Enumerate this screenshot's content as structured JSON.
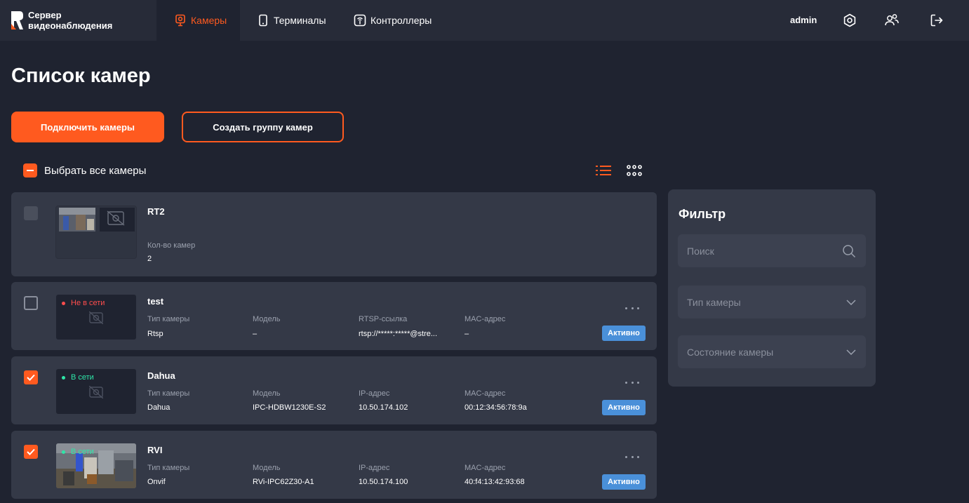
{
  "brand": {
    "line1": "Сервер",
    "line2": "видеонаблюдения"
  },
  "nav": [
    {
      "label": "Камеры",
      "icon": "camera-icon",
      "active": true
    },
    {
      "label": "Терминалы",
      "icon": "terminal-icon",
      "active": false
    },
    {
      "label": "Контроллеры",
      "icon": "controller-icon",
      "active": false
    }
  ],
  "header": {
    "user": "admin"
  },
  "page": {
    "title": "Список камер"
  },
  "actions": {
    "connect": "Подключить камеры",
    "create_group": "Создать группу камер"
  },
  "select_all": {
    "label": "Выбрать все камеры"
  },
  "cards": [
    {
      "title": "RT2",
      "count_label": "Кол-во камер",
      "count_value": "2",
      "checked": false
    },
    {
      "title": "test",
      "status": "Не в сети",
      "checked": false,
      "fields": [
        {
          "label": "Тип камеры",
          "value": "Rtsp"
        },
        {
          "label": "Модель",
          "value": "–"
        },
        {
          "label": "RTSP-ссылка",
          "value": "rtsp://*****:*****@stre..."
        },
        {
          "label": "MAC-адрес",
          "value": "–"
        }
      ],
      "badge": "Активно"
    },
    {
      "title": "Dahua",
      "status": "В сети",
      "checked": true,
      "fields": [
        {
          "label": "Тип камеры",
          "value": "Dahua"
        },
        {
          "label": "Модель",
          "value": "IPC-HDBW1230E-S2"
        },
        {
          "label": "IP-адрес",
          "value": "10.50.174.102"
        },
        {
          "label": "MAC-адрес",
          "value": "00:12:34:56:78:9a"
        }
      ],
      "badge": "Активно"
    },
    {
      "title": "RVI",
      "status": "В сети",
      "checked": true,
      "fields": [
        {
          "label": "Тип камеры",
          "value": "Onvif"
        },
        {
          "label": "Модель",
          "value": "RVi-IPC62Z30-A1"
        },
        {
          "label": "IP-адрес",
          "value": "10.50.174.100"
        },
        {
          "label": "MAC-адрес",
          "value": "40:f4:13:42:93:68"
        }
      ],
      "badge": "Активно"
    }
  ],
  "filter": {
    "title": "Фильтр",
    "search_placeholder": "Поиск",
    "camera_type_placeholder": "Тип камеры",
    "camera_state_placeholder": "Состояние камеры"
  },
  "colors": {
    "accent": "#ff5a1f",
    "online": "#2ee6a8",
    "offline": "#ff4d4d",
    "badge": "#4a90d9",
    "background": "#1f2330",
    "card": "#343947"
  }
}
